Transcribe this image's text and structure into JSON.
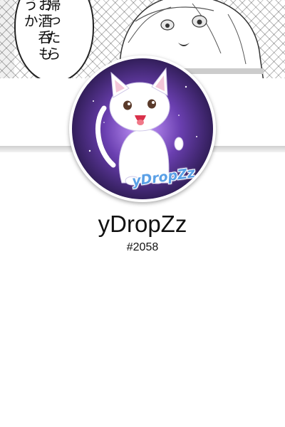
{
  "banner": {
    "manga_text_col1": "帰ったら",
    "manga_text_col2": "お酒呑もうか"
  },
  "avatar": {
    "logo_text": "yDropZz",
    "background_colors": [
      "#1a1035",
      "#6a3fb0",
      "#c79aff"
    ]
  },
  "profile": {
    "username": "yDropZz",
    "discriminator": "#2058"
  }
}
